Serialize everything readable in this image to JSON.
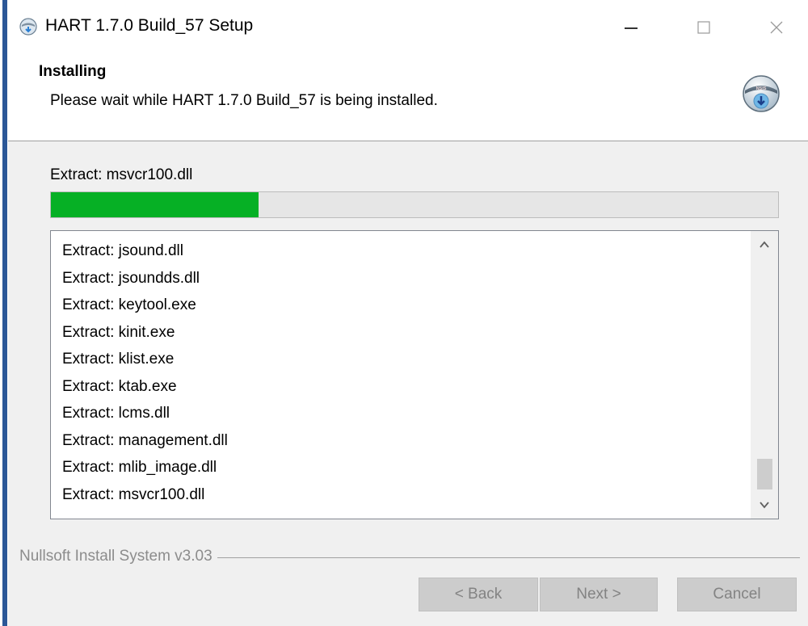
{
  "window": {
    "title": "HART 1.7.0 Build_57 Setup",
    "minimize_glyph": "—",
    "maximize_glyph": "☐",
    "close_glyph": "✕"
  },
  "header": {
    "title": "Installing",
    "subtitle": "Please wait while HART 1.7.0 Build_57 is being installed.",
    "icon": "installer-icon"
  },
  "progress": {
    "status": "Extract: msvcr100.dll",
    "fraction": 0.285,
    "color": "#06b025"
  },
  "log": {
    "items": [
      "Extract: jsound.dll",
      "Extract: jsoundds.dll",
      "Extract: keytool.exe",
      "Extract: kinit.exe",
      "Extract: klist.exe",
      "Extract: ktab.exe",
      "Extract: lcms.dll",
      "Extract: management.dll",
      "Extract: mlib_image.dll",
      "Extract: msvcr100.dll"
    ]
  },
  "footer": {
    "branding": "Nullsoft Install System v3.03",
    "back_label": "< Back",
    "next_label": "Next >",
    "cancel_label": "Cancel"
  }
}
